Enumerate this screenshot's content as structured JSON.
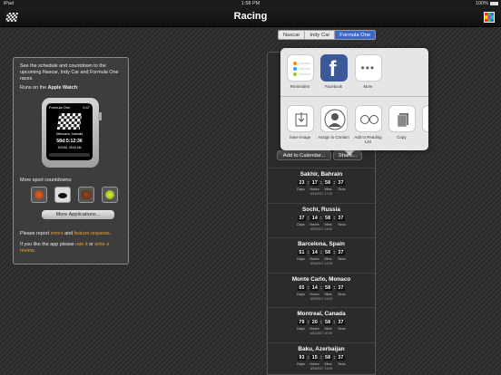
{
  "status": {
    "carrier": "iPad",
    "time": "1:58 PM",
    "battery": "100%"
  },
  "nav": {
    "title": "Racing"
  },
  "segments": [
    {
      "label": "Nascar",
      "active": false
    },
    {
      "label": "Indy Car",
      "active": false
    },
    {
      "label": "Formula One",
      "active": true
    }
  ],
  "left": {
    "intro": "See the schedule and countdown to the upcoming Nascar, Indy Car and Formula One races.",
    "watch_prefix": "Runs on the ",
    "watch_bold": "Apple Watch",
    "watch_suffix": ":",
    "watch": {
      "series": "Formula One",
      "time": "0:47",
      "location": "Melbourne, Australia",
      "countdown": "58d:5:12:36",
      "date": "3/20/16, 05:00 AM"
    },
    "more_sports": "More sport countdowns:",
    "more_apps": "More Applications...",
    "report_1": "Please report ",
    "report_errors": "errors",
    "report_2": " and ",
    "report_features": "feature requests",
    "report_3": ".",
    "like_1": "If you like the app please ",
    "like_rate": "rate it",
    "like_2": " or ",
    "like_review": "write a review",
    "like_3": "."
  },
  "buttons": {
    "add_calendar": "Add to Calendar...",
    "share": "Share..."
  },
  "share_apps": [
    {
      "label": "Reminders"
    },
    {
      "label": "Facebook"
    },
    {
      "label": "More"
    }
  ],
  "share_actions": [
    {
      "label": "Save Image"
    },
    {
      "label": "Assign to Contact"
    },
    {
      "label": "Add to Reading List"
    },
    {
      "label": "Copy"
    }
  ],
  "unit_labels": [
    "Days",
    "Hours",
    "Mins",
    "Secs"
  ],
  "races": [
    {
      "name": "Sakhir, Bahrain",
      "d": "23",
      "h": "17",
      "m": "58",
      "s": "37",
      "date": "4/16/2017  17:00"
    },
    {
      "name": "Sochi, Russia",
      "d": "37",
      "h": "14",
      "m": "58",
      "s": "37",
      "date": "4/30/2017  14:00"
    },
    {
      "name": "Barcelona, Spain",
      "d": "51",
      "h": "14",
      "m": "58",
      "s": "37",
      "date": "5/14/2017  14:00"
    },
    {
      "name": "Monte Carlo, Monaco",
      "d": "65",
      "h": "14",
      "m": "58",
      "s": "37",
      "date": "5/28/2017  14:00"
    },
    {
      "name": "Montreal, Canada",
      "d": "79",
      "h": "20",
      "m": "58",
      "s": "37",
      "date": "6/11/2017  20:00"
    },
    {
      "name": "Baku, Azerbaijan",
      "d": "93",
      "h": "15",
      "m": "58",
      "s": "37",
      "date": "6/25/2017  15:00"
    }
  ]
}
